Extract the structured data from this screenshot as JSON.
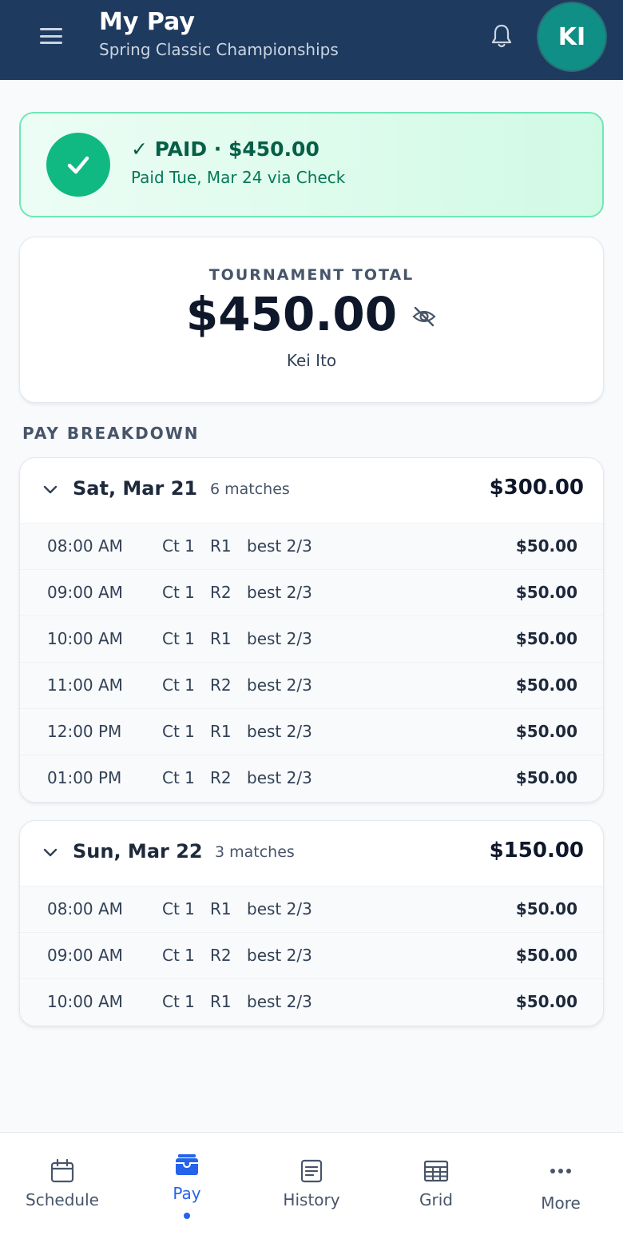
{
  "header": {
    "title": "My Pay",
    "subtitle": "Spring Classic Championships",
    "avatar_initials": "KI"
  },
  "paid_banner": {
    "status_line": "✓ PAID · $450.00",
    "detail_line": "Paid Tue, Mar 24 via Check"
  },
  "total": {
    "label": "TOURNAMENT TOTAL",
    "amount": "$450.00",
    "name": "Kei Ito"
  },
  "breakdown": {
    "heading": "PAY BREAKDOWN",
    "days": [
      {
        "title": "Sat, Mar 21",
        "count": "6 matches",
        "total": "$300.00",
        "matches": [
          {
            "time": "08:00 AM",
            "court": "Ct 1",
            "round": "R1",
            "format": "best 2/3",
            "amount": "$50.00"
          },
          {
            "time": "09:00 AM",
            "court": "Ct 1",
            "round": "R2",
            "format": "best 2/3",
            "amount": "$50.00"
          },
          {
            "time": "10:00 AM",
            "court": "Ct 1",
            "round": "R1",
            "format": "best 2/3",
            "amount": "$50.00"
          },
          {
            "time": "11:00 AM",
            "court": "Ct 1",
            "round": "R2",
            "format": "best 2/3",
            "amount": "$50.00"
          },
          {
            "time": "12:00 PM",
            "court": "Ct 1",
            "round": "R1",
            "format": "best 2/3",
            "amount": "$50.00"
          },
          {
            "time": "01:00 PM",
            "court": "Ct 1",
            "round": "R2",
            "format": "best 2/3",
            "amount": "$50.00"
          }
        ]
      },
      {
        "title": "Sun, Mar 22",
        "count": "3 matches",
        "total": "$150.00",
        "matches": [
          {
            "time": "08:00 AM",
            "court": "Ct 1",
            "round": "R1",
            "format": "best 2/3",
            "amount": "$50.00"
          },
          {
            "time": "09:00 AM",
            "court": "Ct 1",
            "round": "R2",
            "format": "best 2/3",
            "amount": "$50.00"
          },
          {
            "time": "10:00 AM",
            "court": "Ct 1",
            "round": "R1",
            "format": "best 2/3",
            "amount": "$50.00"
          }
        ]
      }
    ]
  },
  "nav": {
    "items": [
      {
        "label": "Schedule",
        "icon": "calendar-icon",
        "active": false
      },
      {
        "label": "Pay",
        "icon": "wallet-icon",
        "active": true
      },
      {
        "label": "History",
        "icon": "document-icon",
        "active": false
      },
      {
        "label": "Grid",
        "icon": "grid-icon",
        "active": false
      },
      {
        "label": "More",
        "icon": "more-icon",
        "active": false
      }
    ]
  },
  "colors": {
    "header_bg": "#1e3a5f",
    "avatar_bg": "#0f8f86",
    "paid_green": "#10b981",
    "accent_blue": "#2563eb"
  }
}
